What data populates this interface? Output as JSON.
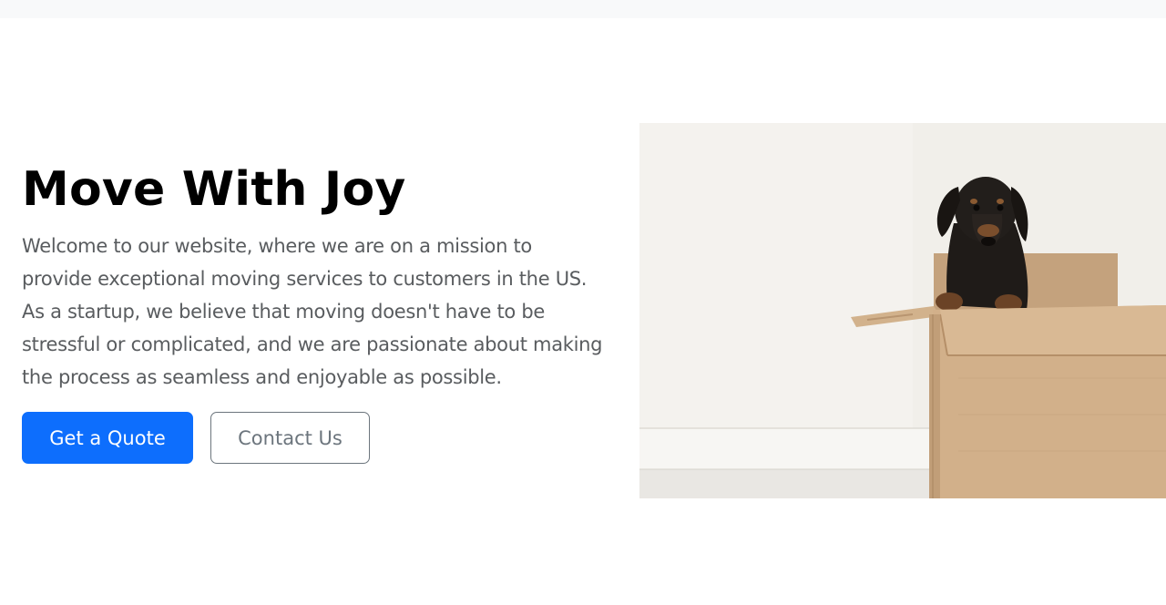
{
  "hero": {
    "title": "Move With Joy",
    "description": "Welcome to our website, where we are on a mission to provide exceptional moving services to customers in the US. As a startup, we believe that moving doesn't have to be stressful or complicated, and we are passionate about making the process as seamless and enjoyable as possible.",
    "primary_button": "Get a Quote",
    "secondary_button": "Contact Us"
  },
  "colors": {
    "primary": "#0d6efd",
    "secondary": "#6c757d",
    "text_muted": "#595c5f",
    "topbar": "#f8f9fa"
  }
}
